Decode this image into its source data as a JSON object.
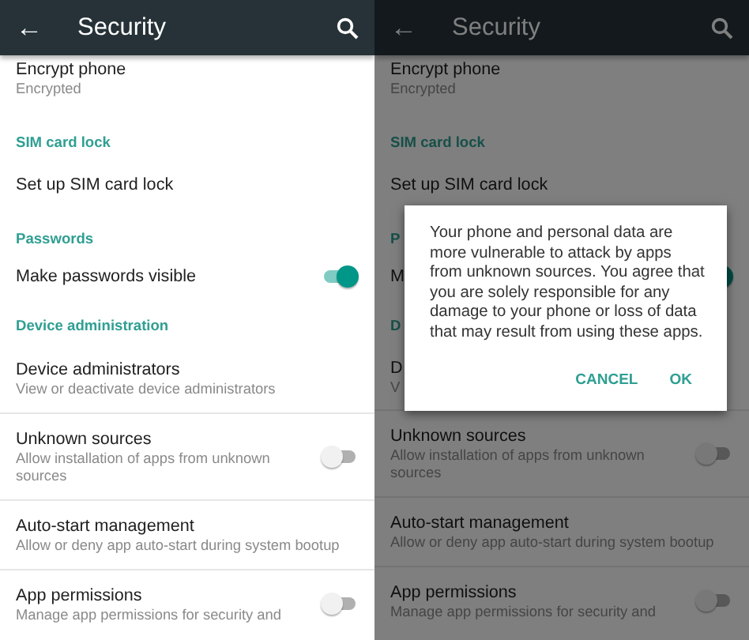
{
  "screens": [
    {
      "dimmed": false,
      "app_bar": {
        "back": "←",
        "title": "Security"
      },
      "items": [
        {
          "kind": "row",
          "title": "Encrypt phone",
          "subtitle": "Encrypted"
        },
        {
          "kind": "header",
          "title": "SIM card lock"
        },
        {
          "kind": "row",
          "title": "Set up SIM card lock"
        },
        {
          "kind": "header",
          "title": "Passwords"
        },
        {
          "kind": "row",
          "title": "Make passwords visible",
          "toggle": {
            "on": true
          }
        },
        {
          "kind": "header",
          "title": "Device administration"
        },
        {
          "kind": "row",
          "title": "Device administrators",
          "subtitle": "View or deactivate device administrators",
          "divider_below": true
        },
        {
          "kind": "row",
          "title": "Unknown sources",
          "subtitle": "Allow installation of apps from unknown sources",
          "toggle": {
            "on": false
          },
          "divider_below": true
        },
        {
          "kind": "row",
          "title": "Auto-start management",
          "subtitle": "Allow or deny app auto-start during system bootup",
          "divider_below": true
        },
        {
          "kind": "row",
          "title": "App permissions",
          "subtitle": "Manage app permissions for security and",
          "toggle": {
            "on": false
          }
        }
      ]
    },
    {
      "dimmed": true,
      "app_bar": {
        "back": "←",
        "title": "Security"
      },
      "items": [
        {
          "kind": "row",
          "title": "Encrypt phone",
          "subtitle": "Encrypted"
        },
        {
          "kind": "header",
          "title": "SIM card lock"
        },
        {
          "kind": "row",
          "title": "Set up SIM card lock"
        },
        {
          "kind": "header",
          "title": "P"
        },
        {
          "kind": "row",
          "title": "M",
          "toggle": {
            "on": true
          }
        },
        {
          "kind": "header",
          "title": "D"
        },
        {
          "kind": "row",
          "title": "D",
          "subtitle": "V",
          "divider_below": true
        },
        {
          "kind": "row",
          "title": "Unknown sources",
          "subtitle": "Allow installation of apps from unknown sources",
          "toggle": {
            "on": false
          },
          "divider_below": true
        },
        {
          "kind": "row",
          "title": "Auto-start management",
          "subtitle": "Allow or deny app auto-start during system bootup",
          "divider_below": true
        },
        {
          "kind": "row",
          "title": "App permissions",
          "subtitle": "Manage app permissions for security and",
          "toggle": {
            "on": false
          }
        }
      ],
      "dialog": {
        "message": "Your phone and personal data are more vulnerable to attack by apps from unknown sources. You agree that you are solely responsible for any damage to your phone or loss of data that may result from using these apps.",
        "buttons": [
          "CANCEL",
          "OK"
        ]
      }
    }
  ]
}
